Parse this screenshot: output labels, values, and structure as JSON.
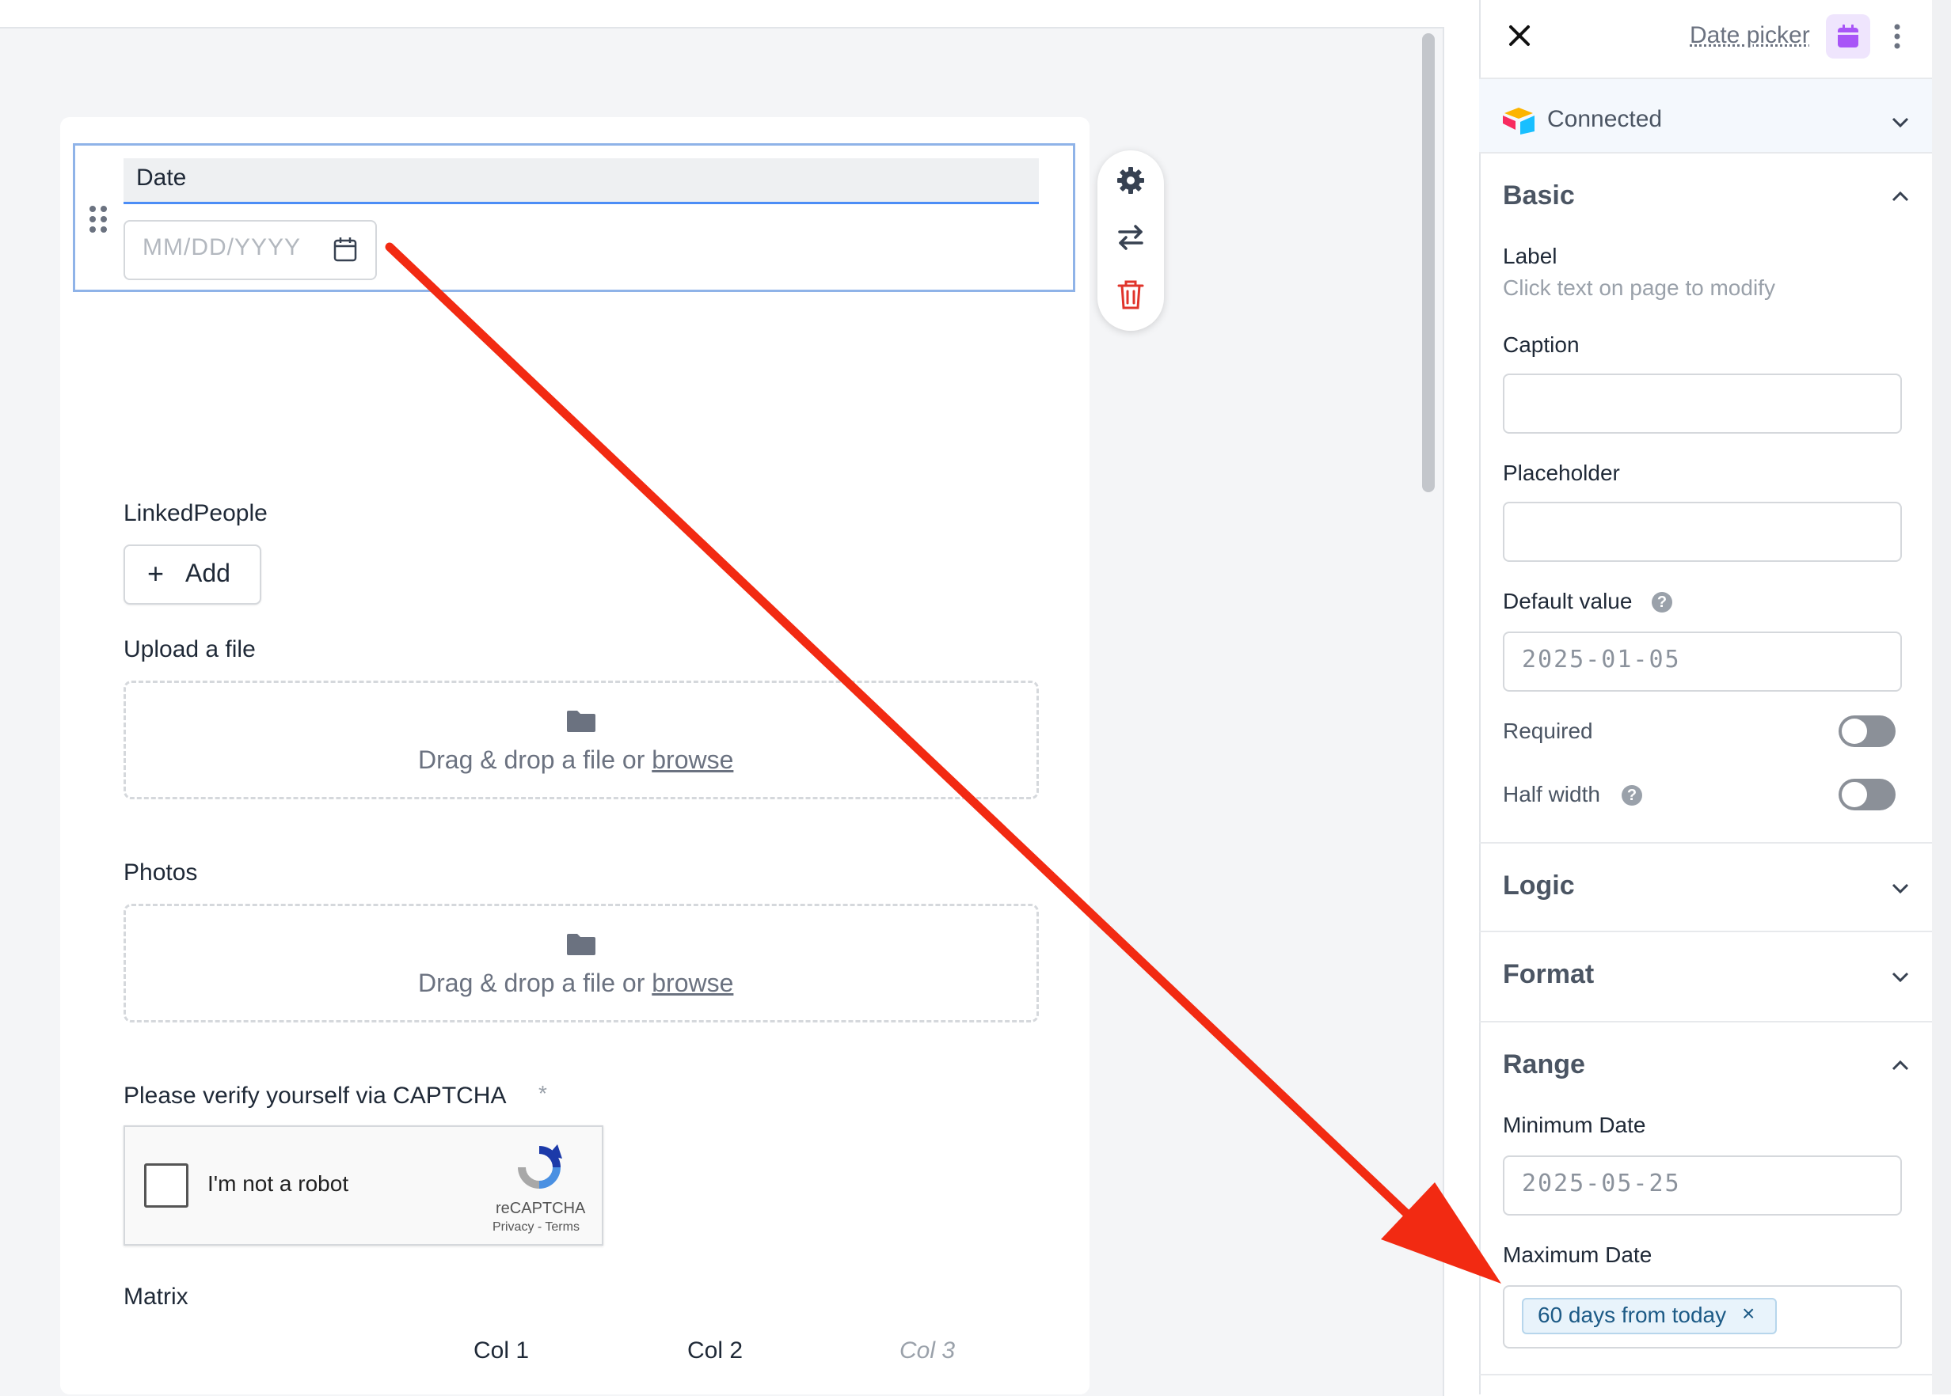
{
  "form": {
    "date_field": {
      "label": "Date",
      "placeholder": "MM/DD/YYYY"
    },
    "linked_people": {
      "label": "LinkedPeople",
      "add_plus": "+",
      "add_label": "Add"
    },
    "upload": {
      "label": "Upload a file",
      "drop_text": "Drag & drop a file or ",
      "browse": "browse"
    },
    "photos": {
      "label": "Photos",
      "drop_text": "Drag & drop a file or ",
      "browse": "browse"
    },
    "captcha": {
      "label": "Please verify yourself via CAPTCHA",
      "required_mark": "*",
      "checkbox_text": "I'm not a robot",
      "brand": "reCAPTCHA",
      "links": "Privacy - Terms"
    },
    "matrix": {
      "label": "Matrix",
      "columns": [
        "Col 1",
        "Col 2",
        "Col 3"
      ]
    }
  },
  "panel": {
    "title": "Date picker",
    "connection": "Connected",
    "sections": {
      "basic": "Basic",
      "logic": "Logic",
      "format": "Format",
      "range": "Range"
    },
    "label_heading": "Label",
    "label_hint": "Click text on page to modify",
    "caption_label": "Caption",
    "caption_value": "",
    "placeholder_label": "Placeholder",
    "placeholder_value": "",
    "default_value_label": "Default value",
    "default_value": "2025-01-05",
    "required_label": "Required",
    "required_on": false,
    "half_width_label": "Half width",
    "half_width_on": false,
    "min_date_label": "Minimum Date",
    "min_date_value": "2025-05-25",
    "max_date_label": "Maximum Date",
    "max_date_tag": "60 days from today",
    "max_date_tag_remove": "×"
  },
  "colors": {
    "selection_border": "#8fb3e8",
    "label_underline": "#4c8df6",
    "annotation_arrow": "#f22a12",
    "tag_bg": "#e8f3fb",
    "tag_text": "#1c5a86"
  }
}
